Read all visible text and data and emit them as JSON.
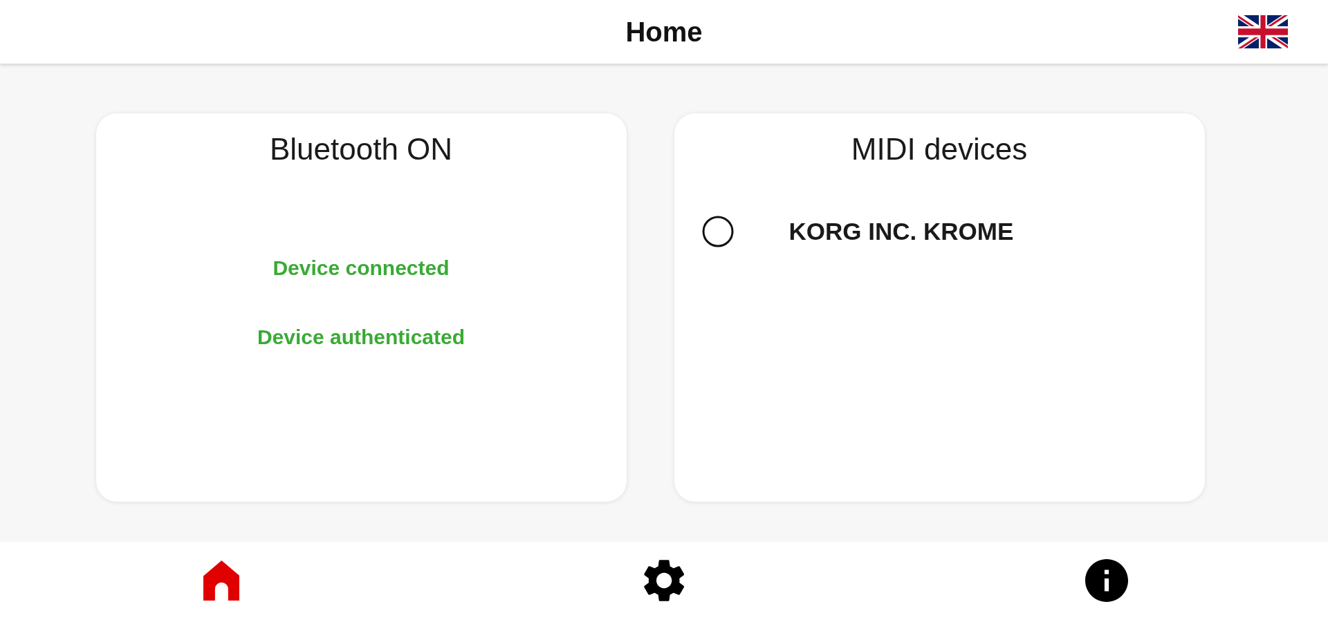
{
  "header": {
    "title": "Home"
  },
  "bluetooth_card": {
    "title": "Bluetooth ON",
    "statuses": [
      {
        "text": "Device connected",
        "ok": true
      },
      {
        "text": "Device authenticated",
        "ok": true
      }
    ]
  },
  "midi_card": {
    "title": "MIDI devices",
    "devices": [
      {
        "name": "KORG INC. KROME",
        "selected": false
      }
    ]
  },
  "nav": {
    "items": [
      {
        "kind": "home",
        "selected": true
      },
      {
        "kind": "settings",
        "selected": false
      },
      {
        "kind": "info",
        "selected": false
      }
    ]
  }
}
